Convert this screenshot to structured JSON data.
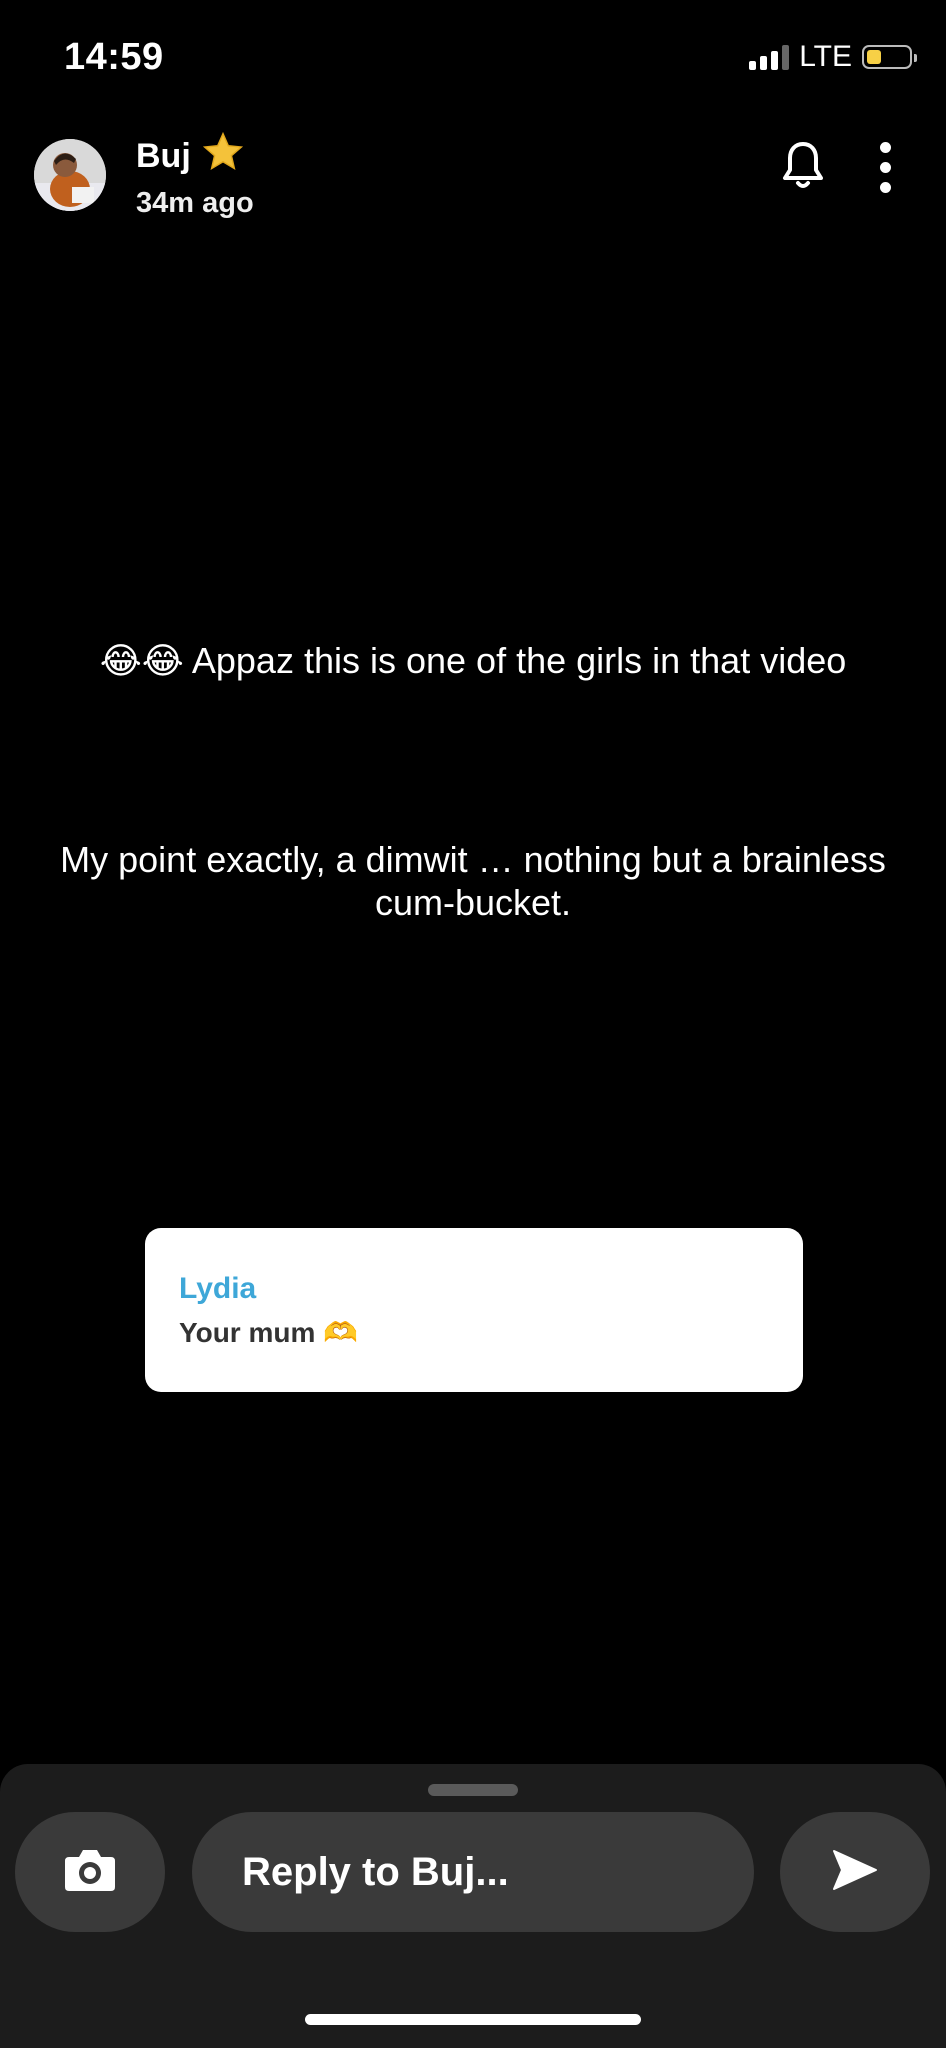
{
  "status_bar": {
    "time": "14:59",
    "network": "LTE",
    "battery_level": 0.35,
    "battery_color": "#f7d046"
  },
  "header": {
    "name": "Buj",
    "badge_icon": "star-icon",
    "time_ago": "34m ago",
    "notification_icon": "bell-icon",
    "menu_icon": "more-vertical-icon"
  },
  "captions": {
    "line1_emoji": "😂😂",
    "line1_text": " Appaz this is one of the girls in that video",
    "line2": "My point exactly, a dimwit … nothing but a brainless cum-bucket."
  },
  "reply_card": {
    "sender": "Lydia",
    "message": "Your mum",
    "message_emoji": "🫶",
    "sender_color": "#3ea7d8"
  },
  "composer": {
    "placeholder": "Reply to Buj...",
    "camera_icon": "camera-icon",
    "send_icon": "send-icon"
  }
}
